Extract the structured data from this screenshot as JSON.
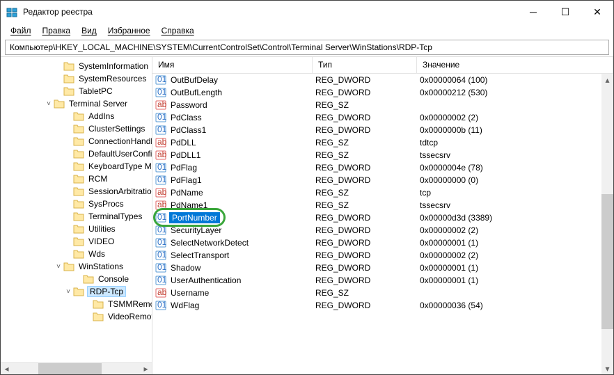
{
  "title": "Редактор реестра",
  "menu": {
    "file": "Файл",
    "edit": "Правка",
    "view": "Вид",
    "favorites": "Избранное",
    "help": "Справка"
  },
  "address": "Компьютер\\HKEY_LOCAL_MACHINE\\SYSTEM\\CurrentControlSet\\Control\\Terminal Server\\WinStations\\RDP-Tcp",
  "columns": {
    "name": "Имя",
    "type": "Тип",
    "value": "Значение"
  },
  "tree": [
    {
      "indent": 72,
      "tw": "",
      "name": "SystemInformation"
    },
    {
      "indent": 72,
      "tw": "",
      "name": "SystemResources"
    },
    {
      "indent": 72,
      "tw": "",
      "name": "TabletPC"
    },
    {
      "indent": 58,
      "tw": "v",
      "name": "Terminal Server"
    },
    {
      "indent": 86,
      "tw": "",
      "name": "AddIns"
    },
    {
      "indent": 86,
      "tw": "",
      "name": "ClusterSettings"
    },
    {
      "indent": 86,
      "tw": "",
      "name": "ConnectionHandler"
    },
    {
      "indent": 86,
      "tw": "",
      "name": "DefaultUserConfiguration"
    },
    {
      "indent": 86,
      "tw": "",
      "name": "KeyboardType Mapping"
    },
    {
      "indent": 86,
      "tw": "",
      "name": "RCM"
    },
    {
      "indent": 86,
      "tw": "",
      "name": "SessionArbitrationHelper"
    },
    {
      "indent": 86,
      "tw": "",
      "name": "SysProcs"
    },
    {
      "indent": 86,
      "tw": "",
      "name": "TerminalTypes"
    },
    {
      "indent": 86,
      "tw": "",
      "name": "Utilities"
    },
    {
      "indent": 86,
      "tw": "",
      "name": "VIDEO"
    },
    {
      "indent": 86,
      "tw": "",
      "name": "Wds"
    },
    {
      "indent": 72,
      "tw": "v",
      "name": "WinStations"
    },
    {
      "indent": 100,
      "tw": "",
      "name": "Console"
    },
    {
      "indent": 86,
      "tw": "v",
      "name": "RDP-Tcp",
      "selected": true
    },
    {
      "indent": 114,
      "tw": "",
      "name": "TSMMRemoting"
    },
    {
      "indent": 114,
      "tw": "",
      "name": "VideoRemoting"
    }
  ],
  "rows": [
    {
      "icon": "dword",
      "name": "OutBufDelay",
      "type": "REG_DWORD",
      "value": "0x00000064 (100)"
    },
    {
      "icon": "dword",
      "name": "OutBufLength",
      "type": "REG_DWORD",
      "value": "0x00000212 (530)"
    },
    {
      "icon": "sz",
      "name": "Password",
      "type": "REG_SZ",
      "value": ""
    },
    {
      "icon": "dword",
      "name": "PdClass",
      "type": "REG_DWORD",
      "value": "0x00000002 (2)"
    },
    {
      "icon": "dword",
      "name": "PdClass1",
      "type": "REG_DWORD",
      "value": "0x0000000b (11)"
    },
    {
      "icon": "sz",
      "name": "PdDLL",
      "type": "REG_SZ",
      "value": "tdtcp"
    },
    {
      "icon": "sz",
      "name": "PdDLL1",
      "type": "REG_SZ",
      "value": "tssecsrv"
    },
    {
      "icon": "dword",
      "name": "PdFlag",
      "type": "REG_DWORD",
      "value": "0x0000004e (78)"
    },
    {
      "icon": "dword",
      "name": "PdFlag1",
      "type": "REG_DWORD",
      "value": "0x00000000 (0)"
    },
    {
      "icon": "sz",
      "name": "PdName",
      "type": "REG_SZ",
      "value": "tcp"
    },
    {
      "icon": "sz",
      "name": "PdName1",
      "type": "REG_SZ",
      "value": "tssecsrv"
    },
    {
      "icon": "dword",
      "name": "PortNumber",
      "type": "REG_DWORD",
      "value": "0x00000d3d (3389)",
      "selected": true
    },
    {
      "icon": "dword",
      "name": "SecurityLayer",
      "type": "REG_DWORD",
      "value": "0x00000002 (2)"
    },
    {
      "icon": "dword",
      "name": "SelectNetworkDetect",
      "type": "REG_DWORD",
      "value": "0x00000001 (1)"
    },
    {
      "icon": "dword",
      "name": "SelectTransport",
      "type": "REG_DWORD",
      "value": "0x00000002 (2)"
    },
    {
      "icon": "dword",
      "name": "Shadow",
      "type": "REG_DWORD",
      "value": "0x00000001 (1)"
    },
    {
      "icon": "dword",
      "name": "UserAuthentication",
      "type": "REG_DWORD",
      "value": "0x00000001 (1)"
    },
    {
      "icon": "sz",
      "name": "Username",
      "type": "REG_SZ",
      "value": ""
    },
    {
      "icon": "dword",
      "name": "WdFlag",
      "type": "REG_DWORD",
      "value": "0x00000036 (54)"
    }
  ]
}
